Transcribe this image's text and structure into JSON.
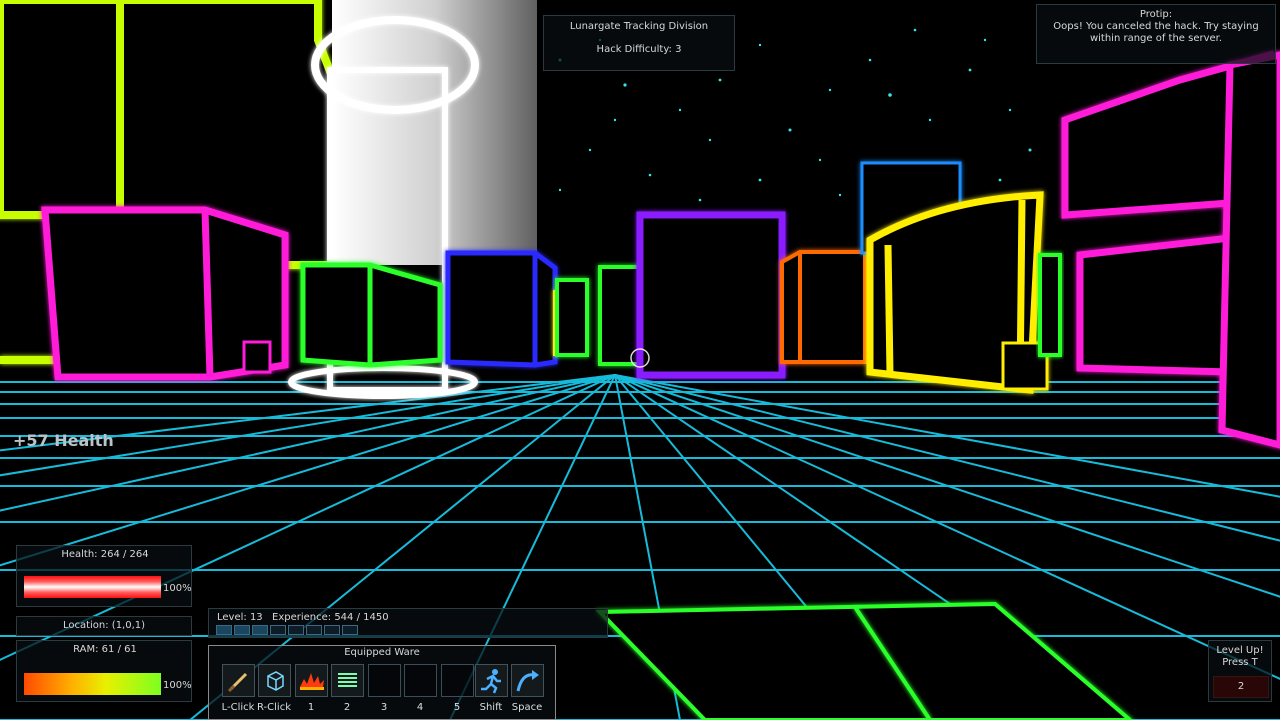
{
  "zone": {
    "name": "Lunargate Tracking Division",
    "difficulty": "Hack Difficulty: 3"
  },
  "protip": {
    "title": "Protip:",
    "text": "Oops! You canceled the hack.  Try staying within range of the server."
  },
  "popup": "+57 Health",
  "health": {
    "label": "Health: 264 / 264",
    "pct_text": "100%",
    "fraction": 1.0,
    "color": "#ff1a1a"
  },
  "location": "Location: (1,0,1)",
  "ram": {
    "label": "RAM: 61 / 61",
    "pct_text": "100%",
    "fraction": 1.0
  },
  "xp": {
    "level": "Level: 13",
    "experience": "Experience: 544 / 1450",
    "segments_total": 8,
    "segments_filled": 3
  },
  "ware": {
    "title": "Equipped Ware",
    "slots": [
      {
        "key": "L-Click",
        "icon": "sword-icon"
      },
      {
        "key": "R-Click",
        "icon": "cube-icon"
      },
      {
        "key": "1",
        "icon": "explosion-icon"
      },
      {
        "key": "2",
        "icon": "coil-icon"
      },
      {
        "key": "3",
        "icon": ""
      },
      {
        "key": "4",
        "icon": ""
      },
      {
        "key": "5",
        "icon": ""
      },
      {
        "key": "Shift",
        "icon": "sprint-icon"
      },
      {
        "key": "Space",
        "icon": "jump-icon"
      }
    ]
  },
  "levelup": {
    "title": "Level Up!",
    "hint": "Press T",
    "count": "2"
  },
  "colors": {
    "grid": "#19c6e6",
    "magenta": "#ff1ad9",
    "green": "#2cff2c",
    "yellow": "#ffee00",
    "violet": "#8a1aff",
    "orange": "#ff6a00",
    "blue": "#2a2aff"
  }
}
